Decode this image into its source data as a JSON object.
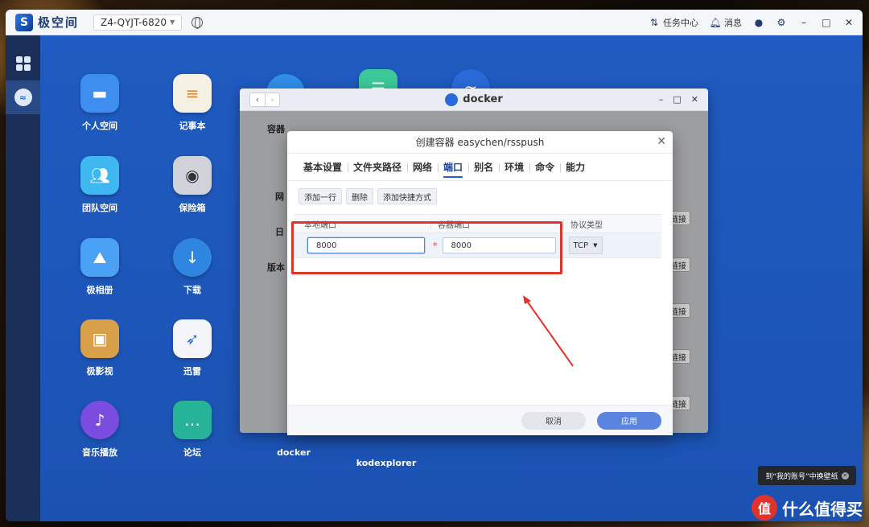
{
  "topbar": {
    "brand": "极空间",
    "logo_letter": "S",
    "device": "Z4-QYJT-6820",
    "task_center": "任务中心",
    "messages": "消息"
  },
  "desktop": {
    "icons": [
      {
        "label": "个人空间",
        "color": "#3e8ef0"
      },
      {
        "label": "记事本",
        "color": "#f5f0e4"
      },
      {
        "label": "团队空间",
        "color": "#3fb7f0"
      },
      {
        "label": "保险箱",
        "color": "#cfd3d9"
      },
      {
        "label": "极相册",
        "color": "#4aa1f5"
      },
      {
        "label": "下载",
        "color": "#2f86e0"
      },
      {
        "label": "极影视",
        "color": "#d9a04a"
      },
      {
        "label": "迅雷",
        "color": "#f3f5f9"
      },
      {
        "label": "音乐播放",
        "color": "#7a4de0"
      },
      {
        "label": "论坛",
        "color": "#27b39a"
      }
    ],
    "bottom_labels": [
      "docker",
      "kodexplorer"
    ]
  },
  "docker": {
    "title": "docker",
    "bg_labels": [
      "容器",
      "网",
      "日",
      "版本"
    ],
    "link_label": "链接"
  },
  "modal": {
    "title": "创建容器 easychen/rsspush",
    "tabs": [
      "基本设置",
      "文件夹路径",
      "网络",
      "端口",
      "别名",
      "环境",
      "命令",
      "能力"
    ],
    "active_tab": "端口",
    "actions": [
      "添加一行",
      "删除",
      "添加快捷方式"
    ],
    "columns": [
      "本地端口",
      "容器端口",
      "协议类型"
    ],
    "row": {
      "local_port": "8000",
      "container_port": "8000",
      "protocol": "TCP"
    },
    "cancel": "取消",
    "apply": "应用"
  },
  "toast": "到“我的账号”中换壁纸",
  "watermark": "什么值得买"
}
